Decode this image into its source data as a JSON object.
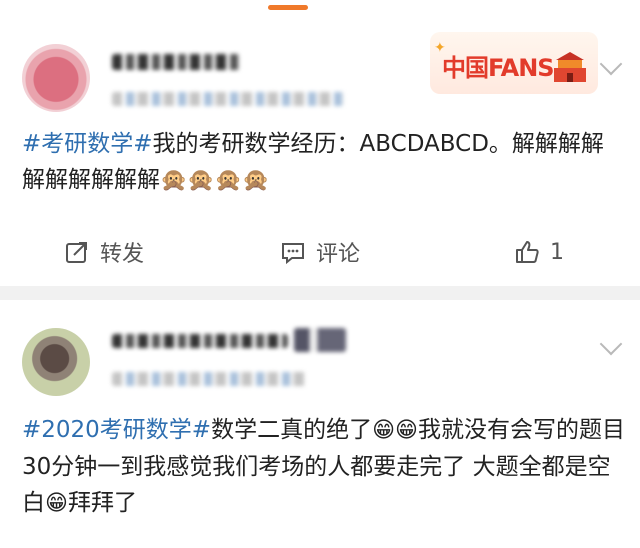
{
  "posts": [
    {
      "content_tag": "#考研数学#",
      "content_text": "我的考研数学经历：ABCDABCD。解解解解解解解解解解",
      "emoji": "🙊🙊🙊🙊",
      "actions": {
        "repost": "转发",
        "comment": "评论",
        "like_count": "1"
      },
      "badge": {
        "text": "中国FANS"
      }
    },
    {
      "content_tag": "#2020考研数学#",
      "content_text_1": "数学二真的绝了",
      "emoji_1": "😁😁",
      "content_text_2": "我就没有会写的题目 30分钟一到我感觉我们考场的人都要走完了 大题全都是空白",
      "emoji_2": "😁",
      "content_text_3": "拜拜了"
    }
  ],
  "colors": {
    "accent": "#f0792a",
    "tag": "#2f6fb0",
    "badge_red": "#e23b2b"
  }
}
